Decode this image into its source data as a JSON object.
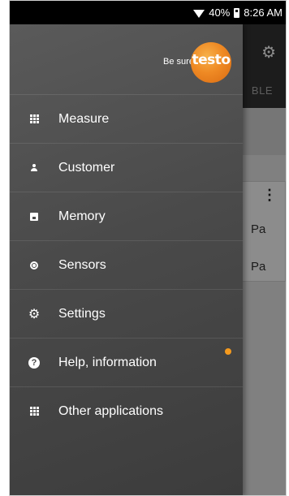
{
  "status_bar": {
    "battery": "40%",
    "time": "8:26 AM"
  },
  "background_app": {
    "tab_fragment": "BLE",
    "card_values": [
      "Pa",
      "Pa"
    ]
  },
  "drawer": {
    "tagline": "Be sure.",
    "logo_text": "testo",
    "items": [
      {
        "label": "Measure",
        "icon": "grid-icon"
      },
      {
        "label": "Customer",
        "icon": "person-icon"
      },
      {
        "label": "Memory",
        "icon": "floppy-disk-icon"
      },
      {
        "label": "Sensors",
        "icon": "sensor-icon"
      },
      {
        "label": "Settings",
        "icon": "gear-icon"
      },
      {
        "label": "Help, information",
        "icon": "help-icon",
        "has_notification": true
      },
      {
        "label": "Other applications",
        "icon": "grid-icon"
      }
    ]
  },
  "colors": {
    "accent": "#F59A1E",
    "drawer_bg": "#4A4A4A",
    "brand": "#E87D1E"
  }
}
